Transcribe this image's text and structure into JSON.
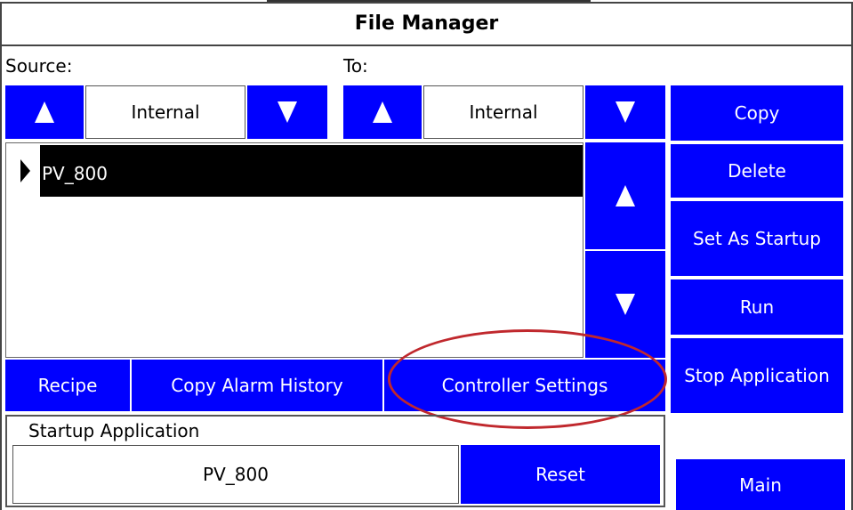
{
  "window": {
    "title": "File Manager"
  },
  "source": {
    "label": "Source:",
    "value": "Internal"
  },
  "destination": {
    "label": "To:",
    "value": "Internal"
  },
  "file_list": {
    "items": [
      {
        "name": "PV_800",
        "selected": true
      }
    ]
  },
  "actions": {
    "copy": "Copy",
    "delete": "Delete",
    "set_as_startup": "Set As Startup",
    "run": "Run",
    "stop_application": "Stop Application",
    "main": "Main"
  },
  "bottom_buttons": {
    "recipe": "Recipe",
    "copy_alarm_history": "Copy Alarm History",
    "controller_settings": "Controller Settings"
  },
  "startup_application": {
    "label": "Startup Application",
    "value": "PV_800",
    "reset": "Reset"
  },
  "icons": {
    "up": "up-arrow-icon",
    "down": "down-arrow-icon",
    "selection": "selection-marker-icon"
  },
  "colors": {
    "button": "#0000ff",
    "highlight_oval": "#c0282d",
    "selected_row": "#000000"
  }
}
